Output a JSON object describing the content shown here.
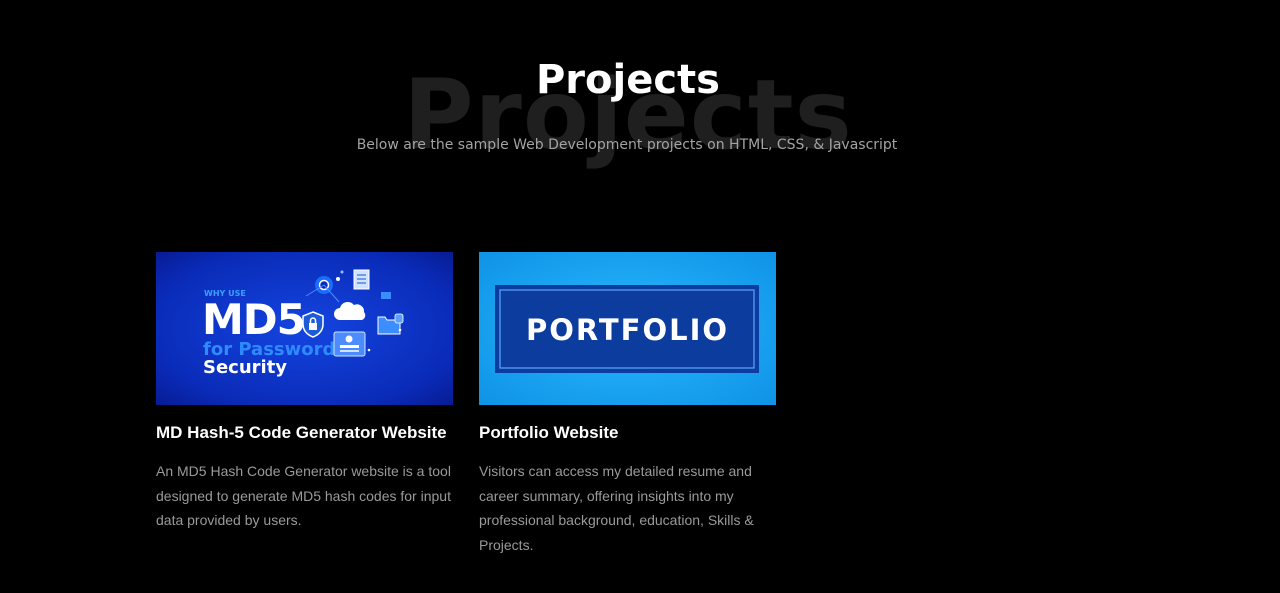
{
  "section": {
    "background_title": "Projects",
    "title": "Projects",
    "subtitle": "Below are the sample Web Development projects on HTML, CSS, & Javascript"
  },
  "projects": [
    {
      "title": "MD Hash-5 Code Generator Website",
      "description": "An MD5 Hash Code Generator website is a tool designed to generate MD5 hash codes for input data provided by users.",
      "image": {
        "kicker": "WHY USE",
        "headline": "MD5",
        "line1": "for Password",
        "line2": "Security",
        "icons": [
          "shield-lock-icon",
          "cloud-icon",
          "document-icon",
          "folder-icon",
          "id-card-icon"
        ]
      }
    },
    {
      "title": "Portfolio Website",
      "description": "Visitors can access my detailed resume and career summary, offering insights into my professional background, education, Skills & Projects.",
      "image": {
        "headline": "PORTFOLIO"
      }
    }
  ],
  "colors": {
    "background": "#000000",
    "heading": "#ffffff",
    "muted_text": "#9a9a9a",
    "md5_bg": "#0a2bb8",
    "portfolio_bg": "#18a4f0",
    "portfolio_banner": "#0b3c9e"
  }
}
